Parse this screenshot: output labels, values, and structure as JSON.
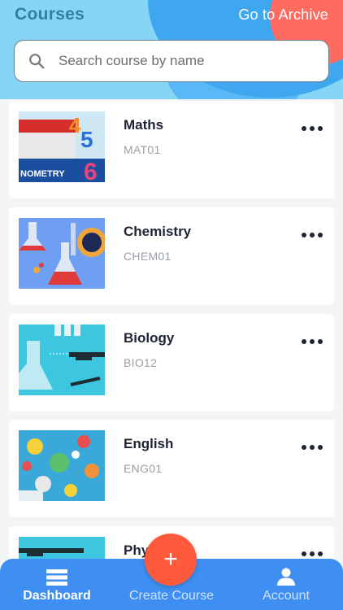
{
  "header": {
    "title": "Courses",
    "archive_label": "Go to Archive"
  },
  "search": {
    "placeholder": "Search course by name",
    "value": ""
  },
  "courses": [
    {
      "name": "Maths",
      "code": "MAT01",
      "thumb": "maths-thumbnail",
      "thumb_text": [
        "4",
        "5",
        "6",
        "NOMETRY"
      ]
    },
    {
      "name": "Chemistry",
      "code": "CHEM01",
      "thumb": "chemistry-thumbnail"
    },
    {
      "name": "Biology",
      "code": "BIO12",
      "thumb": "biology-thumbnail"
    },
    {
      "name": "English",
      "code": "ENG01",
      "thumb": "english-thumbnail"
    },
    {
      "name": "Phy",
      "code": "",
      "thumb": "physics-thumbnail"
    }
  ],
  "fab": {
    "label": "+"
  },
  "nav": {
    "dashboard": "Dashboard",
    "create": "Create Course",
    "account": "Account"
  },
  "colors": {
    "accent": "#3f8ff2",
    "fab": "#ff5a3c",
    "header_light": "#84d6f4"
  }
}
